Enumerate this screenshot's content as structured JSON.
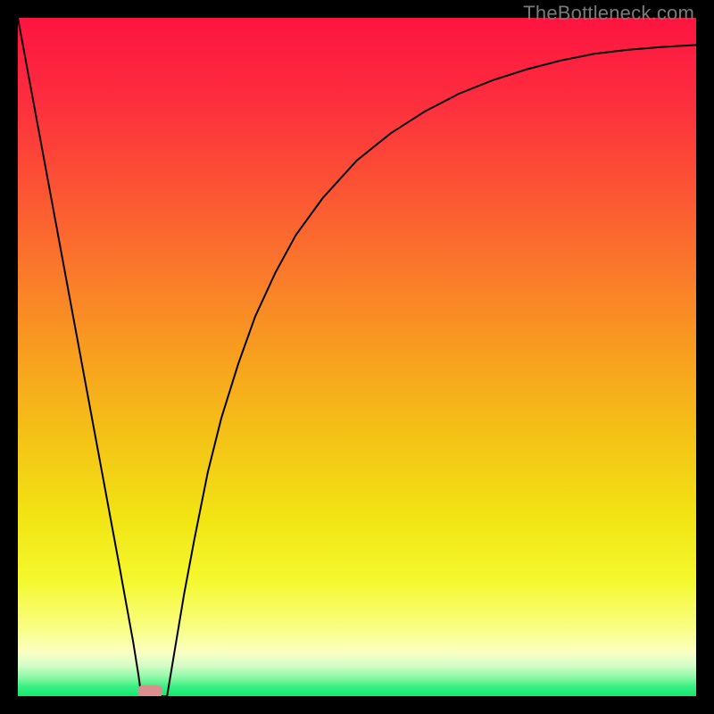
{
  "watermark": "TheBottleneck.com",
  "chart_data": {
    "type": "line",
    "title": "",
    "xlabel": "",
    "ylabel": "",
    "xlim": [
      0,
      1
    ],
    "ylim": [
      0,
      1
    ],
    "legend": false,
    "grid": false,
    "series": [
      {
        "name": "left-branch",
        "x": [
          0.0,
          0.025,
          0.05,
          0.075,
          0.1,
          0.125,
          0.15,
          0.16,
          0.17,
          0.178,
          0.182
        ],
        "y": [
          1.0,
          0.865,
          0.73,
          0.595,
          0.46,
          0.325,
          0.19,
          0.135,
          0.08,
          0.03,
          0.0
        ]
      },
      {
        "name": "floor",
        "x": [
          0.182,
          0.195,
          0.21,
          0.22
        ],
        "y": [
          0.0,
          0.0,
          0.0,
          0.0
        ]
      },
      {
        "name": "right-branch",
        "x": [
          0.22,
          0.23,
          0.245,
          0.26,
          0.28,
          0.3,
          0.325,
          0.35,
          0.38,
          0.41,
          0.45,
          0.5,
          0.55,
          0.6,
          0.65,
          0.7,
          0.75,
          0.8,
          0.85,
          0.9,
          0.95,
          1.0
        ],
        "y": [
          0.0,
          0.06,
          0.15,
          0.23,
          0.33,
          0.41,
          0.49,
          0.56,
          0.625,
          0.68,
          0.735,
          0.79,
          0.83,
          0.862,
          0.888,
          0.908,
          0.924,
          0.937,
          0.947,
          0.953,
          0.957,
          0.96
        ]
      }
    ],
    "marker": {
      "name": "floor-marker",
      "shape": "rounded-rect",
      "color": "#da8f8f",
      "cx": 0.195,
      "cy": 0.007,
      "w": 0.036,
      "h": 0.018
    },
    "background_gradient_stops": [
      {
        "offset": 0.0,
        "color": "#fd1440"
      },
      {
        "offset": 0.12,
        "color": "#fd2d3e"
      },
      {
        "offset": 0.25,
        "color": "#fc5334"
      },
      {
        "offset": 0.38,
        "color": "#fa7b2a"
      },
      {
        "offset": 0.5,
        "color": "#f8a01f"
      },
      {
        "offset": 0.62,
        "color": "#f4c316"
      },
      {
        "offset": 0.74,
        "color": "#f2e514"
      },
      {
        "offset": 0.83,
        "color": "#f4f82f"
      },
      {
        "offset": 0.9,
        "color": "#f9fe84"
      },
      {
        "offset": 0.935,
        "color": "#fbffc3"
      },
      {
        "offset": 0.955,
        "color": "#d3fdc7"
      },
      {
        "offset": 0.972,
        "color": "#8ef8a6"
      },
      {
        "offset": 0.985,
        "color": "#3fef86"
      },
      {
        "offset": 1.0,
        "color": "#0ceb6f"
      }
    ]
  }
}
